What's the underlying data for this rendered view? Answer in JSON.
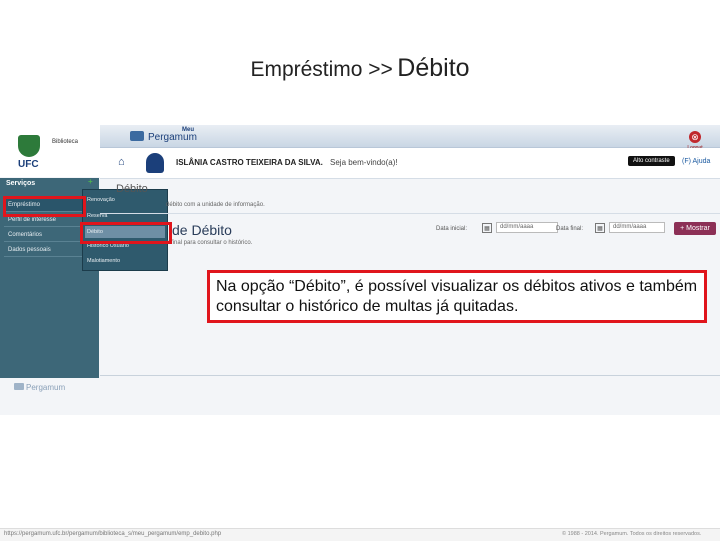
{
  "slide": {
    "title_part1": "Empréstimo >>",
    "title_part2": "Débito"
  },
  "header": {
    "logo_text": "UFC",
    "logo_sub": "Biblioteca",
    "brand_meu": "Meu",
    "brand_name": "Pergamum",
    "logout_label": "Logout",
    "logout_glyph": "⊗"
  },
  "userbar": {
    "home_glyph": "⌂",
    "user_name": "ISLÂNIA CASTRO TEIXEIRA DA SILVA.",
    "welcome": "Seja bem-vindo(a)!",
    "contrast_label": "Alto contraste",
    "help_label": "(F) Ajuda"
  },
  "sidebar": {
    "title": "Serviços",
    "plus_glyph": "+",
    "items": [
      {
        "label": "Empréstimo"
      },
      {
        "label": "Perfil de interesse"
      },
      {
        "label": "Comentários"
      },
      {
        "label": "Dados pessoais"
      }
    ]
  },
  "submenu": {
    "items": [
      {
        "label": "Renovação"
      },
      {
        "label": "Reserva"
      },
      {
        "label": "Débito"
      },
      {
        "label": "Histórico Usuário"
      },
      {
        "label": "Malotiamento"
      }
    ]
  },
  "main": {
    "section_title": "Débito",
    "info_line": "débito com a unidade de informação.",
    "page_title": "de Débito",
    "period_hint": "e final para consultar o histórico.",
    "date_start_label": "Data inicial:",
    "date_start_placeholder": "dd/mm/aaaa",
    "date_end_label": "Data final:",
    "date_end_placeholder": "dd/mm/aaaa",
    "calendar_glyph": "▦",
    "show_button": "+ Mostrar"
  },
  "footer": {
    "logo_text": "Pergamum",
    "url": "https://pergamum.ufc.br/pergamum/biblioteca_s/meu_pergamum/emp_debito.php",
    "copyright": "© 1988 - 2014. Pergamum. Todos os direitos reservados."
  },
  "callout": {
    "text": "Na opção “Débito”, é possível visualizar os débitos ativos e também consultar o histórico de multas já quitadas."
  },
  "colors": {
    "highlight": "#e0151c",
    "sidebar": "#3d6778",
    "button": "#8c3056"
  }
}
